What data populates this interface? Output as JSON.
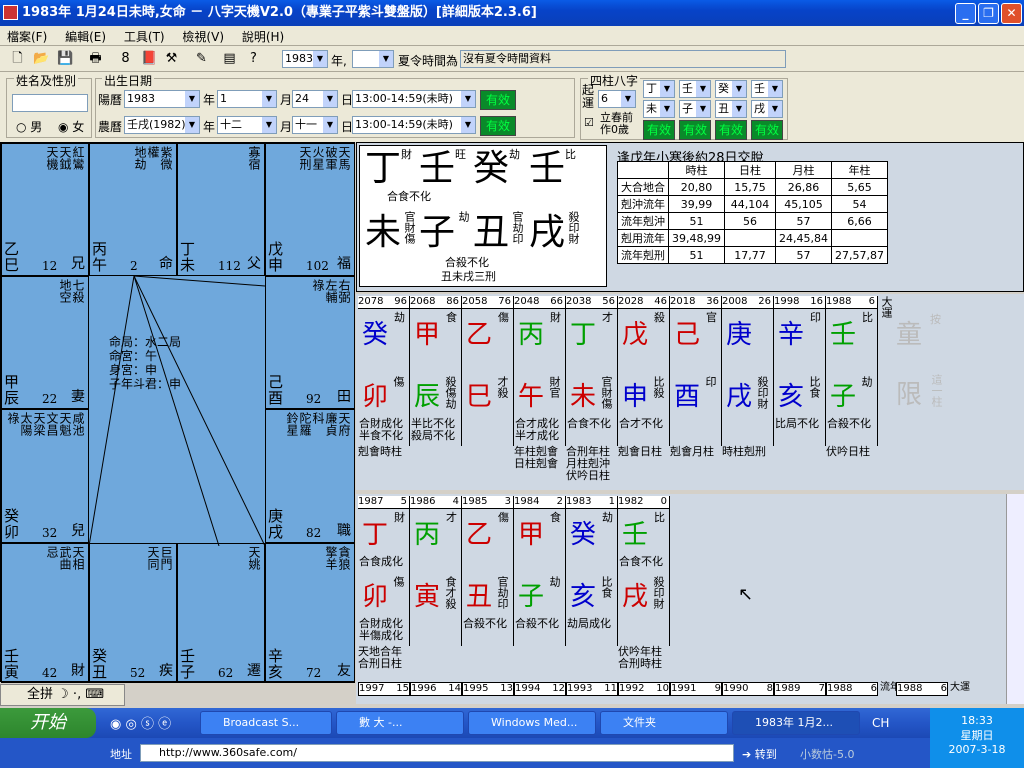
{
  "window": {
    "title": "1983年 1月24日未時,女命 － 八字天機V2.0（專業子平紫斗雙盤版）[詳細版本2.3.6]",
    "min": "_",
    "max": "❐",
    "close": "✕"
  },
  "menu": [
    "檔案(F)",
    "編輯(E)",
    "工具(T)",
    "檢視(V)",
    "說明(H)"
  ],
  "toolbar": {
    "year": "1983",
    "year_suffix": "年,",
    "dst_label": "夏令時間為",
    "dst_value": "沒有夏令時間資料"
  },
  "form": {
    "name_group": "姓名及性別",
    "birth_group": "出生日期",
    "male": "男",
    "female": "女",
    "solar": "陽曆",
    "solar_year": "1983",
    "year_lbl": "年",
    "solar_month": "1",
    "month_lbl": "月",
    "solar_day": "24",
    "day_lbl": "日",
    "solar_time": "13:00-14:59(未時)",
    "ok": "有效",
    "lunar": "農曆",
    "lunar_year": "壬戌(1982)",
    "lunar_month": "十二",
    "lunar_day": "十一",
    "lunar_time": "13:00-14:59(未時)",
    "pillars_group": "四柱八字",
    "qiyun": "起運",
    "qiyun_val": "6",
    "lichun": "立春前作0歲",
    "p1": [
      "丁",
      "壬",
      "癸",
      "壬"
    ],
    "p2": [
      "未",
      "子",
      "丑",
      "戌"
    ]
  },
  "ziwei": {
    "center": [
      "命局：水二局",
      "命宮：午",
      "身宮：申",
      "子年斗君：申"
    ],
    "palaces": [
      {
        "stars": [
          "紅鸞",
          "天鉞",
          "天機"
        ],
        "gz": "乙巳",
        "num": "12",
        "name": "兄"
      },
      {
        "stars": [
          "紫微",
          "權",
          "地劫"
        ],
        "gz": "丙午",
        "num": "2",
        "name": "命"
      },
      {
        "stars": [
          "寡宿"
        ],
        "gz": "丁未",
        "num": "112",
        "name": "父"
      },
      {
        "stars": [
          "天馬",
          "破軍",
          "火星",
          "天刑"
        ],
        "gz": "戊申",
        "num": "102",
        "name": "福"
      },
      {
        "stars": [
          "七殺",
          "地空"
        ],
        "gz": "甲辰",
        "num": "22",
        "name": "妻"
      },
      {
        "stars": [
          "右弼",
          "左輔",
          "祿"
        ],
        "gz": "己酉",
        "num": "92",
        "name": "田"
      },
      {
        "stars": [
          "咸池",
          "天魁",
          "文昌",
          "天梁",
          "太陽",
          "祿"
        ],
        "gz": "癸卯",
        "num": "32",
        "name": "兒"
      },
      {
        "stars": [
          "天府",
          "廉貞",
          "科",
          "陀羅",
          "鈴星"
        ],
        "gz": "庚戌",
        "num": "82",
        "name": "職"
      },
      {
        "stars": [
          "天相",
          "武曲",
          "忌"
        ],
        "gz": "壬寅",
        "num": "42",
        "name": "財"
      },
      {
        "stars": [
          "巨門",
          "天同"
        ],
        "gz": "癸丑",
        "num": "52",
        "name": "疾"
      },
      {
        "stars": [
          "天姚"
        ],
        "gz": "壬子",
        "num": "62",
        "name": "遷"
      },
      {
        "stars": [
          "貪狼",
          "擎羊"
        ],
        "gz": "辛亥",
        "num": "72",
        "name": "友"
      },
      {
        "stars": [
          "天喜",
          "文曲",
          "右弼",
          "祿存",
          "太陰",
          "孤辰"
        ],
        "gz": "",
        "num": "",
        "name": ""
      }
    ]
  },
  "bazi": {
    "stems": [
      "丁",
      "壬",
      "癸",
      "壬"
    ],
    "stem_tags": [
      "財",
      "旺",
      "劫",
      "比"
    ],
    "branches": [
      "未",
      "子",
      "丑",
      "戌"
    ],
    "branch_tags": [
      "官財傷",
      "劫",
      "官劫印",
      "殺印財"
    ],
    "notes": [
      "合食不化",
      "合殺不化",
      "丑未戌三刑"
    ],
    "title": "逢戊年小寒後約28日交脫",
    "table_head": [
      "",
      "時柱",
      "日柱",
      "月柱",
      "年柱"
    ],
    "table": [
      [
        "大合地合",
        "20,80",
        "15,75",
        "26,86",
        "5,65"
      ],
      [
        "剋沖流年",
        "39,99",
        "44,104",
        "45,105",
        "54"
      ],
      [
        "流年剋沖",
        "51",
        "56",
        "57",
        "6,66"
      ],
      [
        "剋用流年",
        "39,48,99",
        "",
        "24,45,84",
        ""
      ],
      [
        "流年剋刑",
        "51",
        "17,77",
        "57",
        "27,57,87"
      ]
    ]
  },
  "dayun": {
    "label": "大運",
    "extra": [
      "童",
      "限",
      "按",
      "這一柱"
    ],
    "cols": [
      {
        "year": "2078",
        "age": "96",
        "stem": "癸",
        "st": "劫",
        "stc": "#0000cc",
        "br": "卯",
        "bt": "傷",
        "brc": "#cc0000",
        "note": "合財成化\n半食不化"
      },
      {
        "year": "2068",
        "age": "86",
        "stem": "甲",
        "st": "食",
        "stc": "#cc0000",
        "br": "辰",
        "bt": "殺傷劫",
        "brc": "#00a000",
        "note": "半比不化\n殺局不化"
      },
      {
        "year": "2058",
        "age": "76",
        "stem": "乙",
        "st": "傷",
        "stc": "#cc0000",
        "br": "巳",
        "bt": "才殺",
        "brc": "#cc0000",
        "note": ""
      },
      {
        "year": "2048",
        "age": "66",
        "stem": "丙",
        "st": "財",
        "stc": "#00a000",
        "br": "午",
        "bt": "財官",
        "brc": "#cc0000",
        "note": "合才成化\n半才成化"
      },
      {
        "year": "2038",
        "age": "56",
        "stem": "丁",
        "st": "才",
        "stc": "#00a000",
        "br": "未",
        "bt": "官財傷",
        "brc": "#cc0000",
        "note": "合食不化"
      },
      {
        "year": "2028",
        "age": "46",
        "stem": "戊",
        "st": "殺",
        "stc": "#cc0000",
        "br": "申",
        "bt": "比殺",
        "brc": "#0000cc",
        "note": "合才不化"
      },
      {
        "year": "2018",
        "age": "36",
        "stem": "己",
        "st": "官",
        "stc": "#cc0000",
        "br": "酉",
        "bt": "印",
        "brc": "#0000cc",
        "note": ""
      },
      {
        "year": "2008",
        "age": "26",
        "stem": "庚",
        "st": "",
        "stc": "#0000cc",
        "br": "戌",
        "bt": "殺印財",
        "brc": "#0000cc",
        "note": ""
      },
      {
        "year": "1998",
        "age": "16",
        "stem": "辛",
        "st": "印",
        "stc": "#0000cc",
        "br": "亥",
        "bt": "比食",
        "brc": "#0000cc",
        "note": "比局不化"
      },
      {
        "year": "1988",
        "age": "6",
        "stem": "壬",
        "st": "比",
        "stc": "#00a000",
        "br": "子",
        "bt": "劫",
        "brc": "#00a000",
        "note": "合殺不化"
      }
    ],
    "bottom": [
      "剋會時柱",
      "",
      "",
      "年柱剋會\n日柱剋會",
      "合刑年柱\n月柱剋沖\n伏吟日柱",
      "剋會日柱",
      "剋會月柱",
      "時柱剋刑",
      "",
      "伏吟日柱"
    ]
  },
  "liunian": {
    "cols": [
      {
        "year": "1987",
        "age": "5",
        "stem": "丁",
        "st": "財",
        "stc": "#cc0000",
        "br": "卯",
        "bt": "傷",
        "brc": "#cc0000",
        "note": "合財成化\n半傷成化"
      },
      {
        "year": "1986",
        "age": "4",
        "stem": "丙",
        "st": "才",
        "stc": "#00a000",
        "br": "寅",
        "bt": "食才殺",
        "brc": "#cc0000",
        "note": ""
      },
      {
        "year": "1985",
        "age": "3",
        "stem": "乙",
        "st": "傷",
        "stc": "#cc0000",
        "br": "丑",
        "bt": "官劫印",
        "brc": "#cc0000",
        "note": "合殺不化"
      },
      {
        "year": "1984",
        "age": "2",
        "stem": "甲",
        "st": "食",
        "stc": "#cc0000",
        "br": "子",
        "bt": "劫",
        "brc": "#00a000",
        "note": "合殺不化"
      },
      {
        "year": "1983",
        "age": "1",
        "stem": "癸",
        "st": "劫",
        "stc": "#0000cc",
        "br": "亥",
        "bt": "比食",
        "brc": "#0000cc",
        "note": "劫局成化"
      },
      {
        "year": "1982",
        "age": "0",
        "stem": "壬",
        "st": "比",
        "stc": "#00a000",
        "br": "戌",
        "bt": "殺印財",
        "brc": "#cc0000",
        "note": ""
      }
    ],
    "stem_notes": [
      "合食成化",
      "",
      "",
      "",
      "",
      "合食不化"
    ],
    "bottom": [
      "天地合年\n合刑日柱",
      "",
      "",
      "",
      "",
      "伏吟年柱\n合刑時柱"
    ],
    "next_row": [
      [
        "1997",
        "15"
      ],
      [
        "1996",
        "14"
      ],
      [
        "1995",
        "13"
      ],
      [
        "1994",
        "12"
      ],
      [
        "1993",
        "11"
      ],
      [
        "1992",
        "10"
      ],
      [
        "1991",
        "9"
      ],
      [
        "1990",
        "8"
      ],
      [
        "1989",
        "7"
      ],
      [
        "1988",
        "6"
      ]
    ],
    "next_label": "流年",
    "next2": [
      "1988",
      "6"
    ],
    "daiyun": "大運"
  },
  "ime": {
    "mode": "全拼"
  },
  "taskbar": {
    "start": "开始",
    "tasks": [
      "Broadcast S...",
      "數 大  -...",
      "Windows Med...",
      "文件夹",
      "1983年 1月2..."
    ],
    "lang": "CH",
    "time": "18:33",
    "weekday": "星期日",
    "date": "2007-3-18"
  },
  "address": {
    "label": "地址",
    "url": "http://www.360safe.com/",
    "go": "转到",
    "brand": "小数怙-5.0"
  }
}
